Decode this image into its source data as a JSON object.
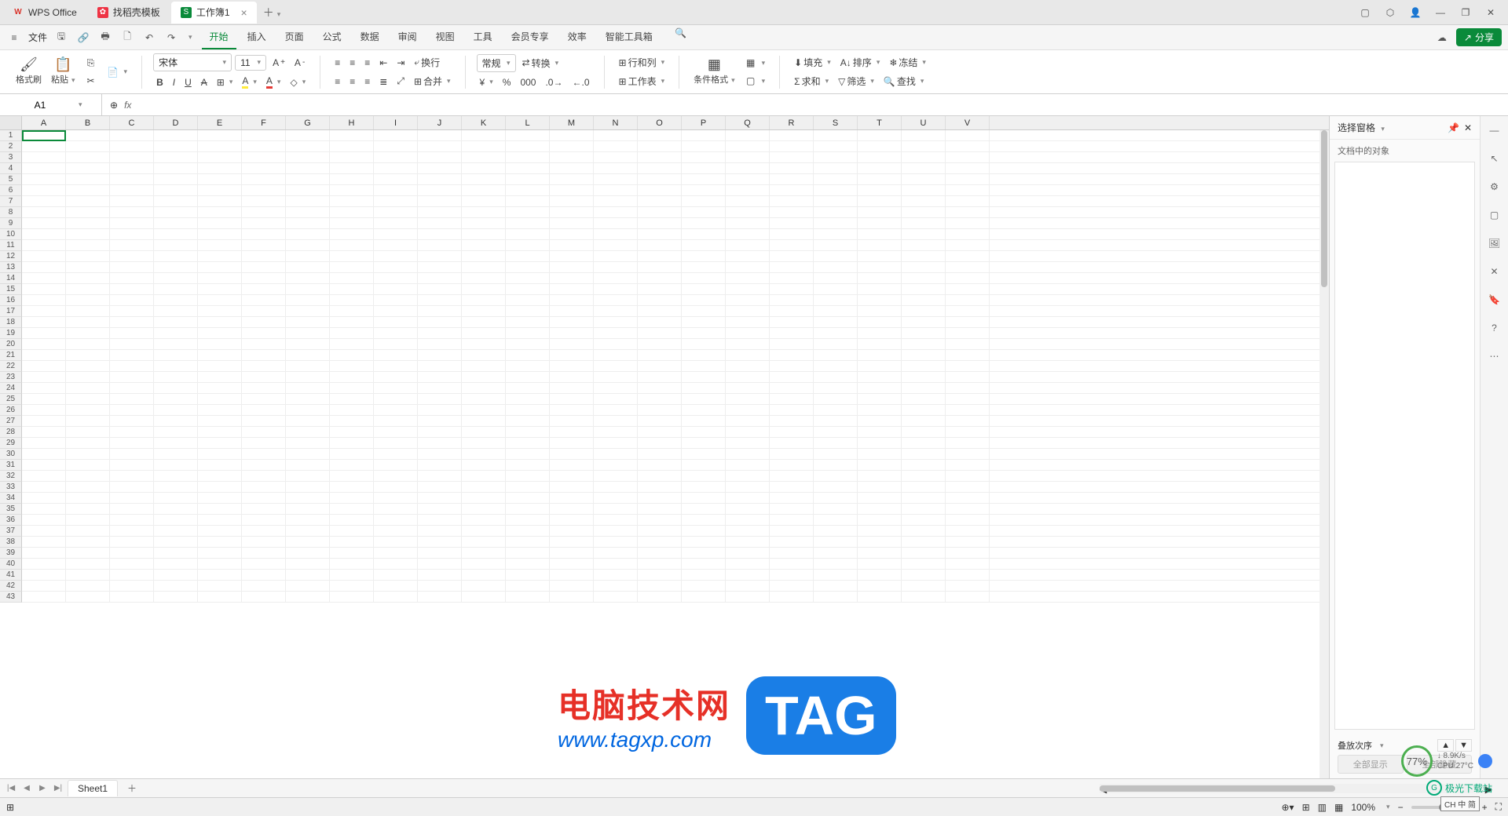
{
  "titlebar": {
    "tabs": [
      {
        "icon": "W",
        "label": "WPS Office",
        "iconClass": "wps-icon"
      },
      {
        "icon": "✿",
        "label": "找稻壳模板",
        "iconClass": "template-icon"
      },
      {
        "icon": "S",
        "label": "工作簿1",
        "iconClass": "sheet-icon",
        "active": true
      }
    ]
  },
  "menu": {
    "file": "文件",
    "tabs": [
      "开始",
      "插入",
      "页面",
      "公式",
      "数据",
      "审阅",
      "视图",
      "工具",
      "会员专享",
      "效率",
      "智能工具箱"
    ],
    "activeTab": "开始",
    "share": "分享"
  },
  "ribbon": {
    "formatPainter": "格式刷",
    "paste": "粘贴",
    "font": "宋体",
    "fontSize": "11",
    "wrap": "换行",
    "merge": "合并",
    "numberFormat": "常规",
    "convert": "转换",
    "rowCol": "行和列",
    "worksheet": "工作表",
    "condFormat": "条件格式",
    "fill": "填充",
    "sort": "排序",
    "freeze": "冻结",
    "sum": "求和",
    "filter": "筛选",
    "find": "查找"
  },
  "formulaBar": {
    "cellRef": "A1",
    "fx": "fx"
  },
  "grid": {
    "columns": [
      "A",
      "B",
      "C",
      "D",
      "E",
      "F",
      "G",
      "H",
      "I",
      "J",
      "K",
      "L",
      "M",
      "N",
      "O",
      "P",
      "Q",
      "R",
      "S",
      "T",
      "U",
      "V"
    ],
    "rowCount": 43
  },
  "sidepanel": {
    "title": "选择窗格",
    "subtitle": "文档中的对象",
    "order": "叠放次序",
    "showAll": "全部显示",
    "hideAll": "全部隐藏"
  },
  "sheets": {
    "active": "Sheet1"
  },
  "status": {
    "zoom": "100%"
  },
  "watermark": {
    "cn": "电脑技术网",
    "url": "www.tagxp.com",
    "tag": "TAG"
  },
  "system": {
    "percent": "77%",
    "netspeed": "8.9K/s",
    "cpu": "CPU 27°C",
    "logo": "极光下载站",
    "ime": "CH 中 简"
  }
}
